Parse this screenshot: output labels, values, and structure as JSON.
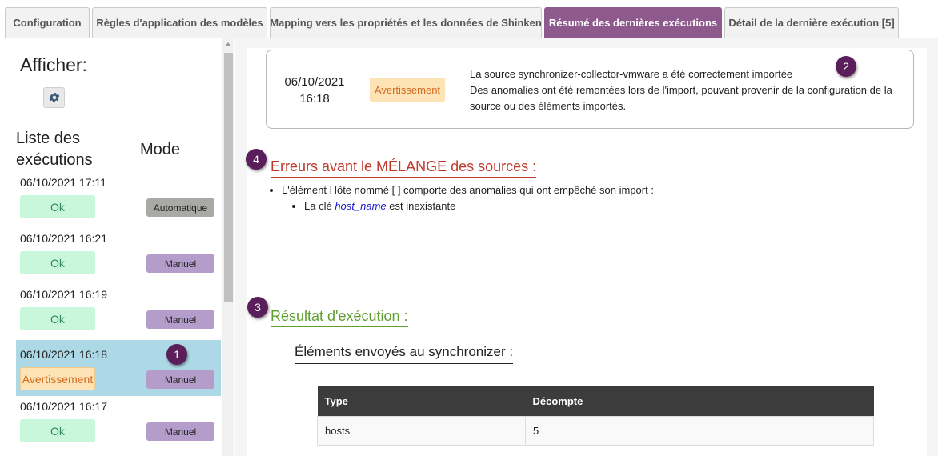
{
  "tabs": [
    {
      "label": "Configuration",
      "active": false
    },
    {
      "label": "Règles d'application des modèles",
      "active": false
    },
    {
      "label": "Mapping vers les propriétés et les données de Shinken",
      "active": false
    },
    {
      "label": "Résumé des dernières exécutions",
      "active": true
    },
    {
      "label": "Détail de la dernière exécution [5]",
      "active": false
    }
  ],
  "sidebar": {
    "afficher_label": "Afficher:",
    "settings_icon": "gear-icon",
    "list_title": "Liste des exécutions",
    "mode_title": "Mode",
    "runs": [
      {
        "date": "06/10/2021 17:11",
        "status": "Ok",
        "mode": "Automatique",
        "selected": false
      },
      {
        "date": "06/10/2021 16:21",
        "status": "Ok",
        "mode": "Manuel",
        "selected": false
      },
      {
        "date": "06/10/2021 16:19",
        "status": "Ok",
        "mode": "Manuel",
        "selected": false
      },
      {
        "date": "06/10/2021 16:18",
        "status": "Avertissement",
        "mode": "Manuel",
        "selected": true
      },
      {
        "date": "06/10/2021 16:17",
        "status": "Ok",
        "mode": "Manuel",
        "selected": false
      }
    ]
  },
  "markers": {
    "m1": "1",
    "m2": "2",
    "m3": "3",
    "m4": "4"
  },
  "summary": {
    "date_line1": "06/10/2021",
    "date_line2": "16:18",
    "status": "Avertissement",
    "message_line1": "La source synchronizer-collector-vmware a été correctement importée",
    "message_line2": "Des anomalies ont été remontées lors de l'import, pouvant provenir de la configuration de la source ou des éléments importés."
  },
  "errors": {
    "title": "Erreurs avant le MÉLANGE des sources :",
    "item": "L'élément Hôte nommé [ ] comporte des anomalies qui ont empêché son import :",
    "sub_prefix": "La clé ",
    "sub_key": "host_name",
    "sub_suffix": " est inexistante"
  },
  "result": {
    "title": "Résultat d'exécution :",
    "sent_title": "Éléments envoyés au synchronizer :",
    "table": {
      "headers": [
        "Type",
        "Décompte"
      ],
      "rows": [
        [
          "hosts",
          "5"
        ]
      ]
    }
  },
  "colors": {
    "active_tab": "#8e5a8e",
    "selected_row": "#add8e6",
    "ok_badge": "#c8f7dc",
    "warning_badge": "#fde3b5",
    "manual_badge": "#b49ccb",
    "auto_badge": "#a9aaa6",
    "marker": "#5a1f5a",
    "errors_title": "#c0392b",
    "result_title": "#5f9e2f"
  }
}
